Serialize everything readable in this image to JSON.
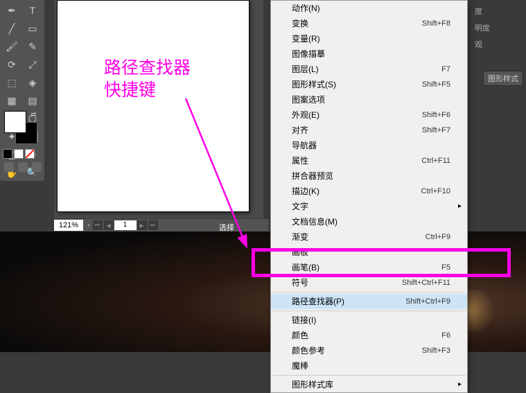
{
  "annotation": {
    "line1": "路径查找器",
    "line2": "快捷键"
  },
  "statusbar": {
    "zoom": "121%",
    "page": "1",
    "selection": "选择"
  },
  "rightpanel": {
    "item1": "度",
    "item2": "明度",
    "item3": "观",
    "tab": "图形样式"
  },
  "menu": {
    "items": [
      {
        "label": "动作(N)",
        "shortcut": "",
        "sep": false
      },
      {
        "label": "变换",
        "shortcut": "Shift+F8",
        "sep": false
      },
      {
        "label": "变量(R)",
        "shortcut": "",
        "sep": false
      },
      {
        "label": "图像描摹",
        "shortcut": "",
        "sep": false
      },
      {
        "label": "图层(L)",
        "shortcut": "F7",
        "sep": false
      },
      {
        "label": "图形样式(S)",
        "shortcut": "Shift+F5",
        "sep": false
      },
      {
        "label": "图案选项",
        "shortcut": "",
        "sep": false
      },
      {
        "label": "外观(E)",
        "shortcut": "Shift+F6",
        "sep": false
      },
      {
        "label": "对齐",
        "shortcut": "Shift+F7",
        "sep": false
      },
      {
        "label": "导航器",
        "shortcut": "",
        "sep": false
      },
      {
        "label": "属性",
        "shortcut": "Ctrl+F11",
        "sep": false
      },
      {
        "label": "拼合器预览",
        "shortcut": "",
        "sep": false
      },
      {
        "label": "描边(K)",
        "shortcut": "Ctrl+F10",
        "sep": false
      },
      {
        "label": "文字",
        "shortcut": "",
        "sep": false,
        "arrow": true
      },
      {
        "label": "文档信息(M)",
        "shortcut": "",
        "sep": false
      },
      {
        "label": "渐变",
        "shortcut": "Ctrl+F9",
        "sep": false
      },
      {
        "label": "画板",
        "shortcut": "",
        "sep": false
      },
      {
        "label": "画笔(B)",
        "shortcut": "F5",
        "sep": false
      },
      {
        "label": "符号",
        "shortcut": "Shift+Ctrl+F11",
        "sep": false
      },
      {
        "label": "",
        "shortcut": "",
        "sep": true
      },
      {
        "label": "路径查找器(P)",
        "shortcut": "Shift+Ctrl+F9",
        "sep": false,
        "highlight": true
      },
      {
        "label": "",
        "shortcut": "",
        "sep": true
      },
      {
        "label": "链接(I)",
        "shortcut": "",
        "sep": false
      },
      {
        "label": "颜色",
        "shortcut": "F6",
        "sep": false
      },
      {
        "label": "颜色参考",
        "shortcut": "Shift+F3",
        "sep": false
      },
      {
        "label": "魔棒",
        "shortcut": "",
        "sep": false
      },
      {
        "label": "",
        "shortcut": "",
        "sep": true
      },
      {
        "label": "图形样式库",
        "shortcut": "",
        "sep": false,
        "arrow": true
      }
    ]
  },
  "tools": [
    "pen",
    "text",
    "line",
    "rect",
    "brush",
    "pencil",
    "rotate",
    "scale",
    "width",
    "shapebuilder",
    "mesh",
    "gradient",
    "eyedropper",
    "blend",
    "symbol",
    "graph",
    "artboard",
    "slice",
    "hand",
    "zoom"
  ]
}
